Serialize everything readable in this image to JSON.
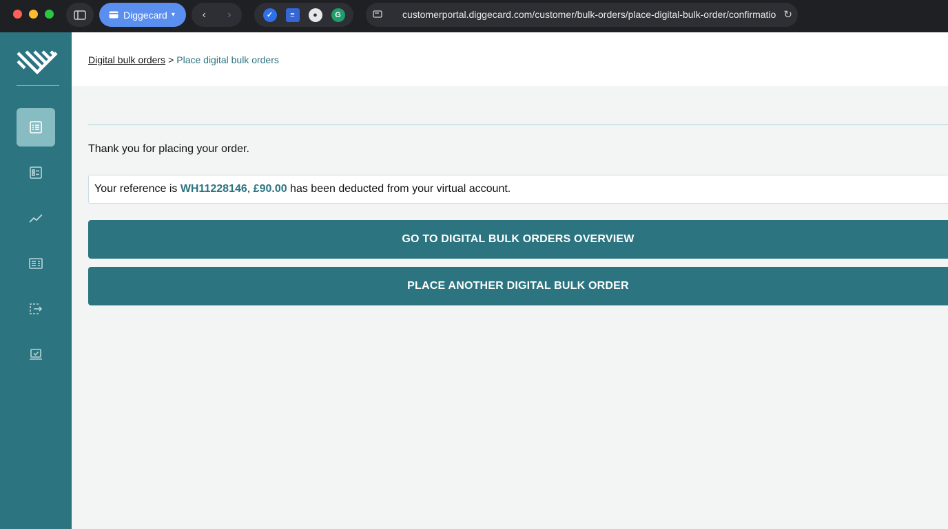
{
  "browser": {
    "tab_group_label": "Diggecard",
    "url": "customerportal.diggecard.com/customer/bulk-orders/place-digital-bulk-order/confirmatio"
  },
  "breadcrumb": {
    "parent": "Digital bulk orders",
    "separator": ">",
    "current": "Place digital bulk orders"
  },
  "main": {
    "thank_you": "Thank you for placing your order.",
    "reference": {
      "prefix": "Your reference is ",
      "code": "WH11228146",
      "comma": ", ",
      "amount": "£90.00",
      "suffix": " has been deducted from your virtual account."
    },
    "buttons": {
      "overview": "GO TO DIGITAL BULK ORDERS OVERVIEW",
      "another": "PLACE ANOTHER DIGITAL BULK ORDER"
    }
  },
  "sidebar": {
    "items": [
      {
        "icon": "list-document-icon",
        "active": true
      },
      {
        "icon": "checklist-icon",
        "active": false
      },
      {
        "icon": "trend-line-icon",
        "active": false
      },
      {
        "icon": "newspaper-icon",
        "active": false
      },
      {
        "icon": "transfer-icon",
        "active": false
      },
      {
        "icon": "laptop-check-icon",
        "active": false
      }
    ]
  },
  "colors": {
    "brand": "#2c7480",
    "sidebar_active": "#88bcc3",
    "background": "#f3f5f4"
  }
}
